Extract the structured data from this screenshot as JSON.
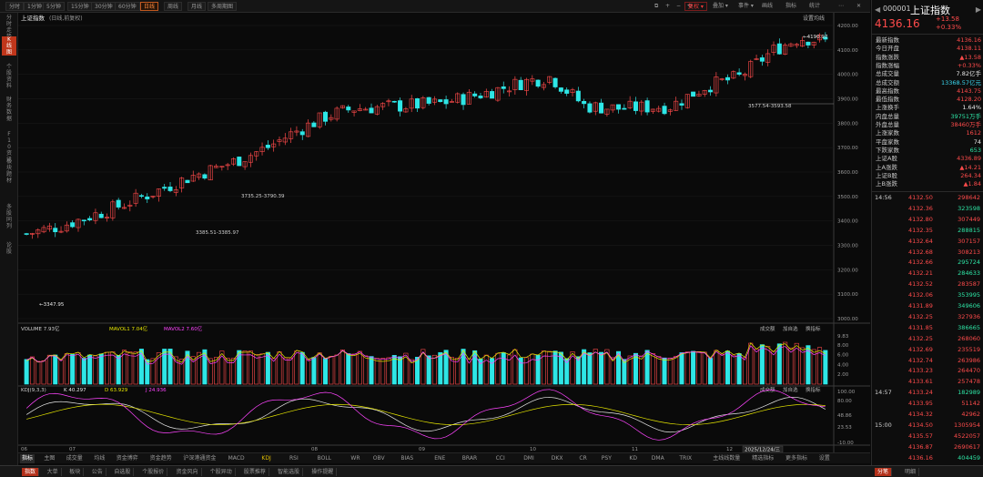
{
  "toolbar": {
    "periods": [
      "分时",
      "1分钟",
      "5分钟",
      "15分钟",
      "30分钟",
      "60分钟",
      "日线",
      "周线",
      "月线",
      "多周期图"
    ],
    "active_period": "日线",
    "right_buttons": [
      "复权",
      "叠加",
      "事件",
      "画线",
      "指标",
      "统计"
    ],
    "active_right": "复权",
    "settings_label": "设置均线"
  },
  "left_sidebar": [
    "分时走势",
    "K线图",
    "个股资料",
    "财务数据",
    "F10资讯",
    "板块题材",
    "多股同列",
    "论股"
  ],
  "chart_header": {
    "index_name": "上证指数",
    "index_note": "(日线,前复权)",
    "vol_label": "VOLUME 7.93亿",
    "vol_ma1": "MAVOL1 7.04亿",
    "vol_ma2": "MAVOL2 7.60亿",
    "kdj_label": "KDJ(9,3,3)",
    "kdj_k": "K 40.297",
    "kdj_d": "D 63.929",
    "kdj_j": "J 24.936",
    "vol_buttons": [
      "成交额",
      "加自选",
      "换指标"
    ],
    "kdj_buttons": [
      "成交额",
      "加自选",
      "换指标"
    ],
    "date_label": "2025/12/24/三"
  },
  "annotations": {
    "high": "4190.97",
    "low": "3347.95",
    "range1": "3577.54-3593.58",
    "range2": "3735.25-3790.39",
    "range3": "3385.51-3385.97"
  },
  "price_axis": [
    "4200.00",
    "4100.00",
    "4000.00",
    "3900.00",
    "3800.00",
    "3700.00",
    "3600.00",
    "3500.00",
    "3400.00",
    "3300.00",
    "3200.00",
    "3100.00",
    "3000.00"
  ],
  "vol_axis": [
    "9.83",
    "8.00",
    "6.00",
    "4.00",
    "2.00"
  ],
  "kdj_axis": [
    "100.00",
    "80.00",
    "48.86",
    "23.53",
    "-10.00"
  ],
  "x_axis": [
    "06",
    "07",
    "08",
    "09",
    "10",
    "11",
    "12"
  ],
  "bottom_tabs": [
    "指标",
    "主图",
    "成交量",
    "均线",
    "资金博弈",
    "资金趋势",
    "沪深港通资金",
    "MACD",
    "KDJ",
    "RSI",
    "BOLL",
    "WR",
    "OBV",
    "BIAS",
    "ENE",
    "BRAR",
    "CCI",
    "DMI",
    "DKX",
    "CR",
    "PSY",
    "KD",
    "DMA",
    "TRIX",
    "主线线数量",
    "精选指标",
    "更多指标",
    "设置"
  ],
  "bottom_active": "KDJ",
  "status_bar": [
    "指数",
    "大单",
    "板块",
    "公告",
    "自选股",
    "个股报价",
    "资金风向",
    "个股异动",
    "股票推荐",
    "智能选股",
    "操作提醒"
  ],
  "status_active": "指数",
  "quote": {
    "code": "000001",
    "name": "上证指数",
    "price": "4136.16",
    "change": "+13.58",
    "change_pct": "+0.33%",
    "stats": [
      {
        "k": "最新指数",
        "v": "4136.16",
        "c": "red"
      },
      {
        "k": "今日开盘",
        "v": "4138.11",
        "c": "red"
      },
      {
        "k": "指数涨跌",
        "v": "▲13.58",
        "c": "red"
      },
      {
        "k": "指数涨幅",
        "v": "+0.33%",
        "c": "red"
      },
      {
        "k": "总成交量",
        "v": "7.82亿手",
        "c": "white"
      },
      {
        "k": "总成交额",
        "v": "13368.57亿元",
        "c": "cyan"
      },
      {
        "k": "最高指数",
        "v": "4143.75",
        "c": "red"
      },
      {
        "k": "最低指数",
        "v": "4128.20",
        "c": "red"
      },
      {
        "k": "上涨换手",
        "v": "1.64%",
        "c": "white"
      },
      {
        "k": "内盘总量",
        "v": "39751万手",
        "c": "green"
      },
      {
        "k": "外盘总量",
        "v": "38460万手",
        "c": "red"
      },
      {
        "k": "上涨家数",
        "v": "1612",
        "c": "red"
      },
      {
        "k": "平盘家数",
        "v": "74",
        "c": "white"
      },
      {
        "k": "下跌家数",
        "v": "653",
        "c": "green"
      },
      {
        "k": "上证A股",
        "v": "4336.89",
        "c": "red"
      },
      {
        "k": "上A涨跌",
        "v": "▲14.21",
        "c": "red"
      },
      {
        "k": "上证B股",
        "v": "264.34",
        "c": "red"
      },
      {
        "k": "上B涨跌",
        "v": "▲1.84",
        "c": "red"
      }
    ],
    "ticks": [
      {
        "t": "14:56",
        "p": "4132.50",
        "q": "298642",
        "c": "red"
      },
      {
        "t": "",
        "p": "4132.36",
        "q": "323598",
        "c": "green"
      },
      {
        "t": "",
        "p": "4132.80",
        "q": "307449",
        "c": "red"
      },
      {
        "t": "",
        "p": "4132.35",
        "q": "288815",
        "c": "green"
      },
      {
        "t": "",
        "p": "4132.64",
        "q": "307157",
        "c": "red"
      },
      {
        "t": "",
        "p": "4132.68",
        "q": "308213",
        "c": "red"
      },
      {
        "t": "",
        "p": "4132.66",
        "q": "295724",
        "c": "green"
      },
      {
        "t": "",
        "p": "4132.21",
        "q": "284633",
        "c": "green"
      },
      {
        "t": "",
        "p": "4132.52",
        "q": "283587",
        "c": "red"
      },
      {
        "t": "",
        "p": "4132.06",
        "q": "353995",
        "c": "green"
      },
      {
        "t": "",
        "p": "4131.89",
        "q": "349606",
        "c": "green"
      },
      {
        "t": "",
        "p": "4132.25",
        "q": "327936",
        "c": "red"
      },
      {
        "t": "",
        "p": "4131.85",
        "q": "386665",
        "c": "green"
      },
      {
        "t": "",
        "p": "4132.25",
        "q": "268060",
        "c": "red"
      },
      {
        "t": "",
        "p": "4132.69",
        "q": "235519",
        "c": "red"
      },
      {
        "t": "",
        "p": "4132.74",
        "q": "263986",
        "c": "red"
      },
      {
        "t": "",
        "p": "4133.23",
        "q": "264470",
        "c": "red"
      },
      {
        "t": "",
        "p": "4133.61",
        "q": "257478",
        "c": "red"
      },
      {
        "t": "14:57",
        "p": "4133.24",
        "q": "182989",
        "c": "green"
      },
      {
        "t": "",
        "p": "4133.95",
        "q": "51142",
        "c": "red"
      },
      {
        "t": "",
        "p": "4134.32",
        "q": "42962",
        "c": "red"
      },
      {
        "t": "15:00",
        "p": "4134.50",
        "q": "1305954",
        "c": "red"
      },
      {
        "t": "",
        "p": "4135.57",
        "q": "4522057",
        "c": "red"
      },
      {
        "t": "",
        "p": "4136.87",
        "q": "2690617",
        "c": "red"
      },
      {
        "t": "",
        "p": "4136.16",
        "q": "404459",
        "c": "green"
      }
    ],
    "bottom_tabs": [
      "分笔",
      "明细"
    ]
  }
}
